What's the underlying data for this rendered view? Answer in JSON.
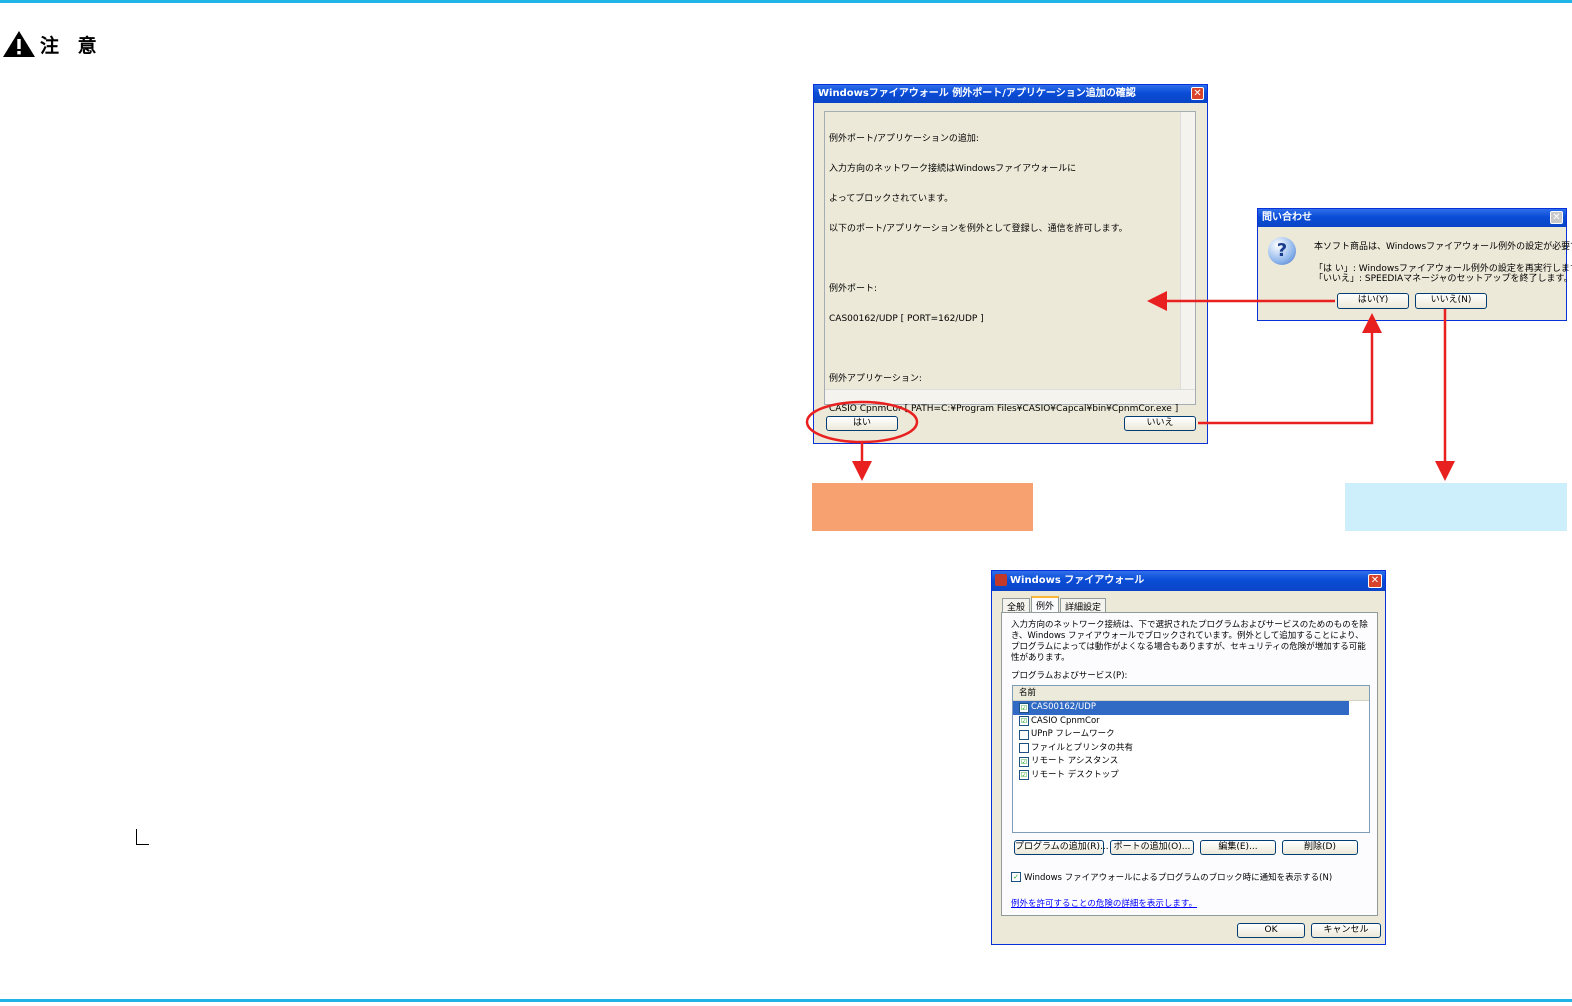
{
  "caution": {
    "label": "注 意"
  },
  "colors": {
    "accent_rule": "#1fb3e6",
    "arrow": "#e8201f",
    "orange_box": "#f7a070",
    "blue_box": "#cdeefb"
  },
  "dialog_confirm": {
    "title": "Windowsファイアウォール 例外ポート/アプリケーション追加の確認",
    "lines": [
      "例外ポート/アプリケーションの追加:",
      "入力方向のネットワーク接続はWindowsファイアウォールに",
      "よってブロックされています。",
      "以下のポート/アプリケーションを例外として登録し、通信を許可します。",
      "",
      "例外ポート:",
      "CAS00162/UDP [ PORT=162/UDP ]",
      "",
      "例外アプリケーション:",
      "CASIO CpnmCor [ PATH=C:¥Program Files¥CASIO¥Capcal¥bin¥CpnmCor.exe ]"
    ],
    "yes_label": "はい",
    "no_label": "いいえ",
    "close_glyph": "✕"
  },
  "dialog_query": {
    "title": "問い合わせ",
    "message": "本ソフト商品は、Windowsファイアウォール例外の設定が必要です。",
    "yes_hint": "「は い」: Windowsファイアウォール例外の設定を再実行します。",
    "no_hint": "「いいえ」: SPEEDIAマネージャのセットアップを終了します。",
    "yes_label": "はい(Y)",
    "no_label": "いいえ(N)",
    "icon": "question-icon",
    "close_glyph": "✕"
  },
  "firewall_window": {
    "title": "Windows ファイアウォール",
    "tabs": [
      "全般",
      "例外",
      "詳細設定"
    ],
    "active_tab": "例外",
    "description": "入力方向のネットワーク接続は、下で選択されたプログラムおよびサービスのためのものを除き、Windows ファイアウォールでブロックされています。例外として追加することにより、プログラムによっては動作がよくなる場合もありますが、セキュリティの危険が増加する可能性があります。",
    "section_label": "プログラムおよびサービス(P):",
    "column_header": "名前",
    "items": [
      {
        "name": "CAS00162/UDP",
        "checked": "☑"
      },
      {
        "name": "CASIO CpnmCor",
        "checked": "☑"
      },
      {
        "name": "UPnP フレームワーク",
        "checked": ""
      },
      {
        "name": "ファイルとプリンタの共有",
        "checked": ""
      },
      {
        "name": "リモート アシスタンス",
        "checked": "☑"
      },
      {
        "name": "リモート デスクトップ",
        "checked": "☑"
      }
    ],
    "buttons": [
      "プログラムの追加(R)...",
      "ポートの追加(O)...",
      "編集(E)...",
      "削除(D)"
    ],
    "notify_label": "Windows ファイアウォールによるプログラムのブロック時に通知を表示する(N)",
    "link_text": "例外を許可することの危険の詳細を表示します。",
    "ok_label": "OK",
    "cancel_label": "キャンセル",
    "close_glyph": "✕"
  }
}
